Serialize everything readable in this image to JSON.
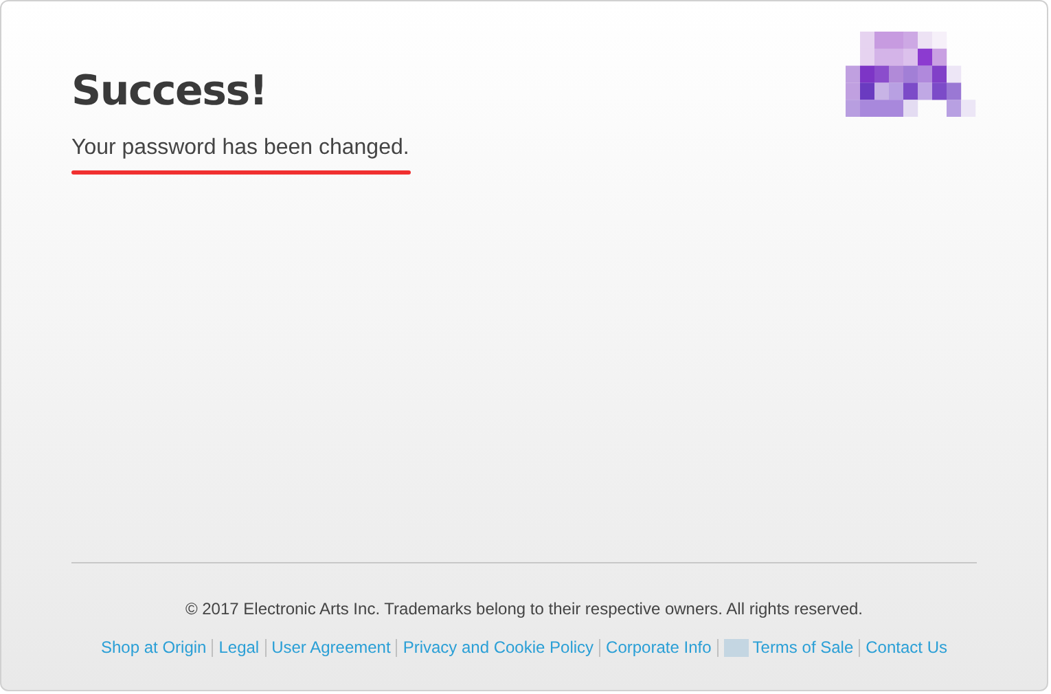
{
  "title": "Success!",
  "message": "Your password has been changed.",
  "footer": {
    "copyright": "© 2017 Electronic Arts Inc. Trademarks belong to their respective owners. All rights reserved.",
    "links": [
      {
        "label": "Shop at Origin"
      },
      {
        "label": "Legal"
      },
      {
        "label": "User Agreement"
      },
      {
        "label": "Privacy and Cookie Policy"
      },
      {
        "label": "Corporate Info"
      },
      {
        "label": "Terms of Sale",
        "kind": "with-block"
      },
      {
        "label": "Contact Us"
      }
    ]
  }
}
